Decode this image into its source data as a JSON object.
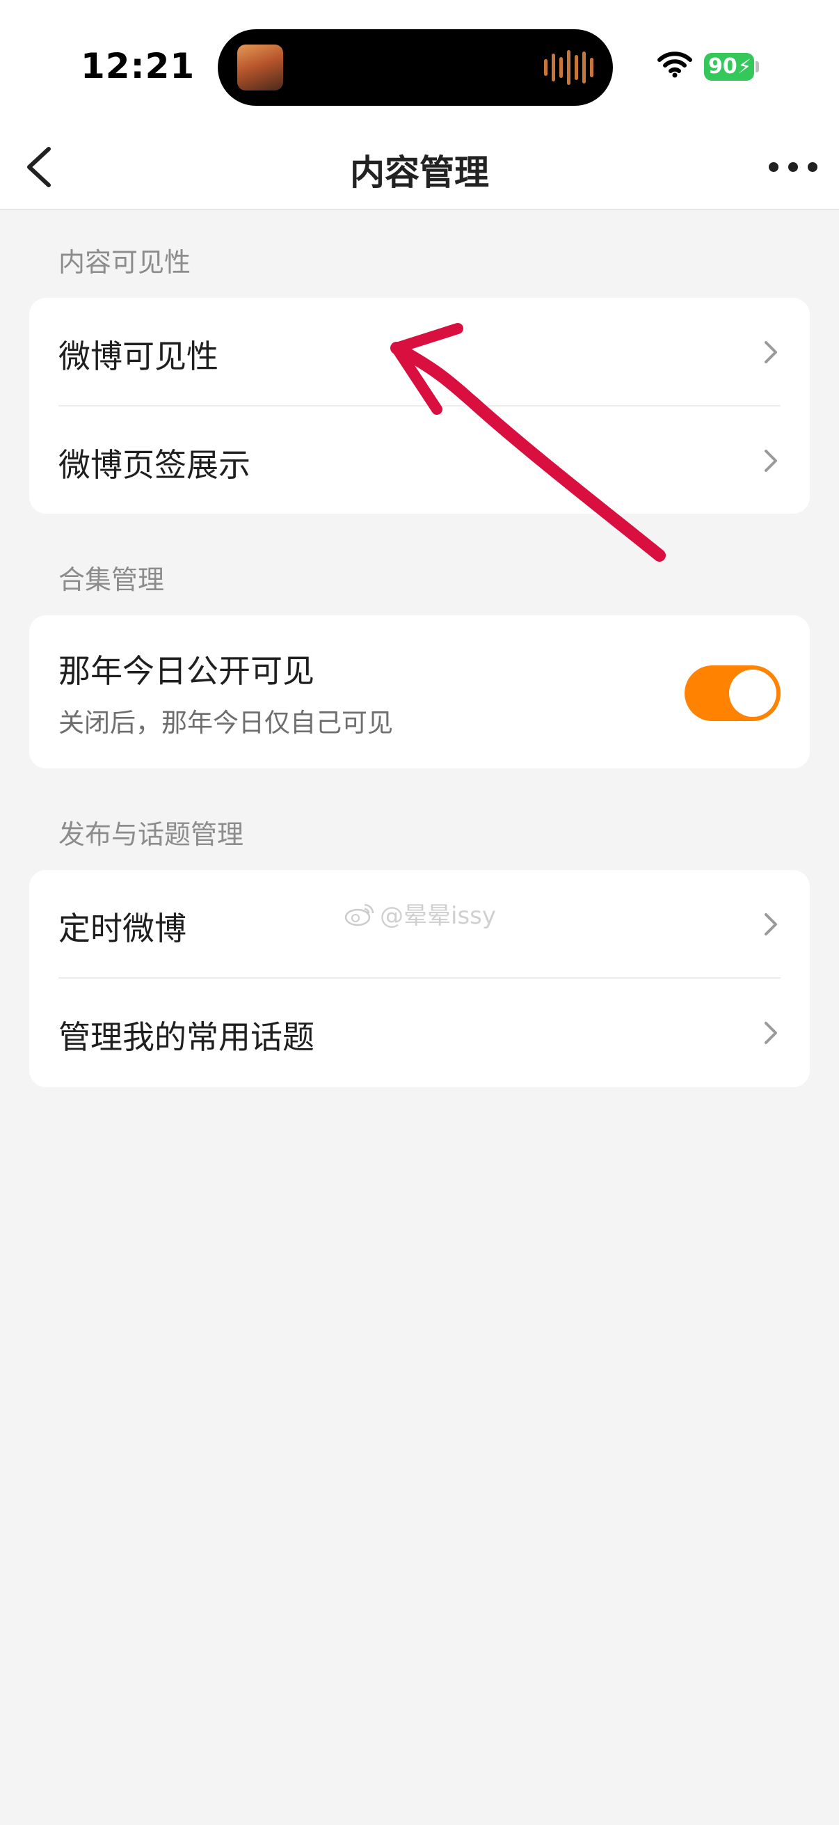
{
  "status_bar": {
    "time": "12:21",
    "battery_level": "90",
    "battery_color": "#34c759",
    "icons": [
      "music-artwork-icon",
      "audio-waveform-icon",
      "wifi-icon",
      "battery-icon"
    ]
  },
  "nav": {
    "title": "内容管理",
    "back_icon": "chevron-left-icon",
    "more_icon": "more-dots-icon"
  },
  "sections": {
    "visibility": {
      "header": "内容可见性",
      "items": [
        {
          "label": "微博可见性",
          "icon": "chevron-right-icon"
        },
        {
          "label": "微博页签展示",
          "icon": "chevron-right-icon"
        }
      ]
    },
    "collection": {
      "header": "合集管理",
      "toggle": {
        "title": "那年今日公开可见",
        "subtitle": "关闭后，那年今日仅自己可见",
        "state": "on",
        "color": "#ff8200"
      }
    },
    "publish": {
      "header": "发布与话题管理",
      "items": [
        {
          "label": "定时微博",
          "icon": "chevron-right-icon"
        },
        {
          "label": "管理我的常用话题",
          "icon": "chevron-right-icon"
        }
      ]
    }
  },
  "watermark": {
    "text": "@晕晕issy",
    "icon": "weibo-logo-icon"
  },
  "annotation": {
    "icon": "red-arrow-annotation",
    "color": "#d9103f"
  }
}
